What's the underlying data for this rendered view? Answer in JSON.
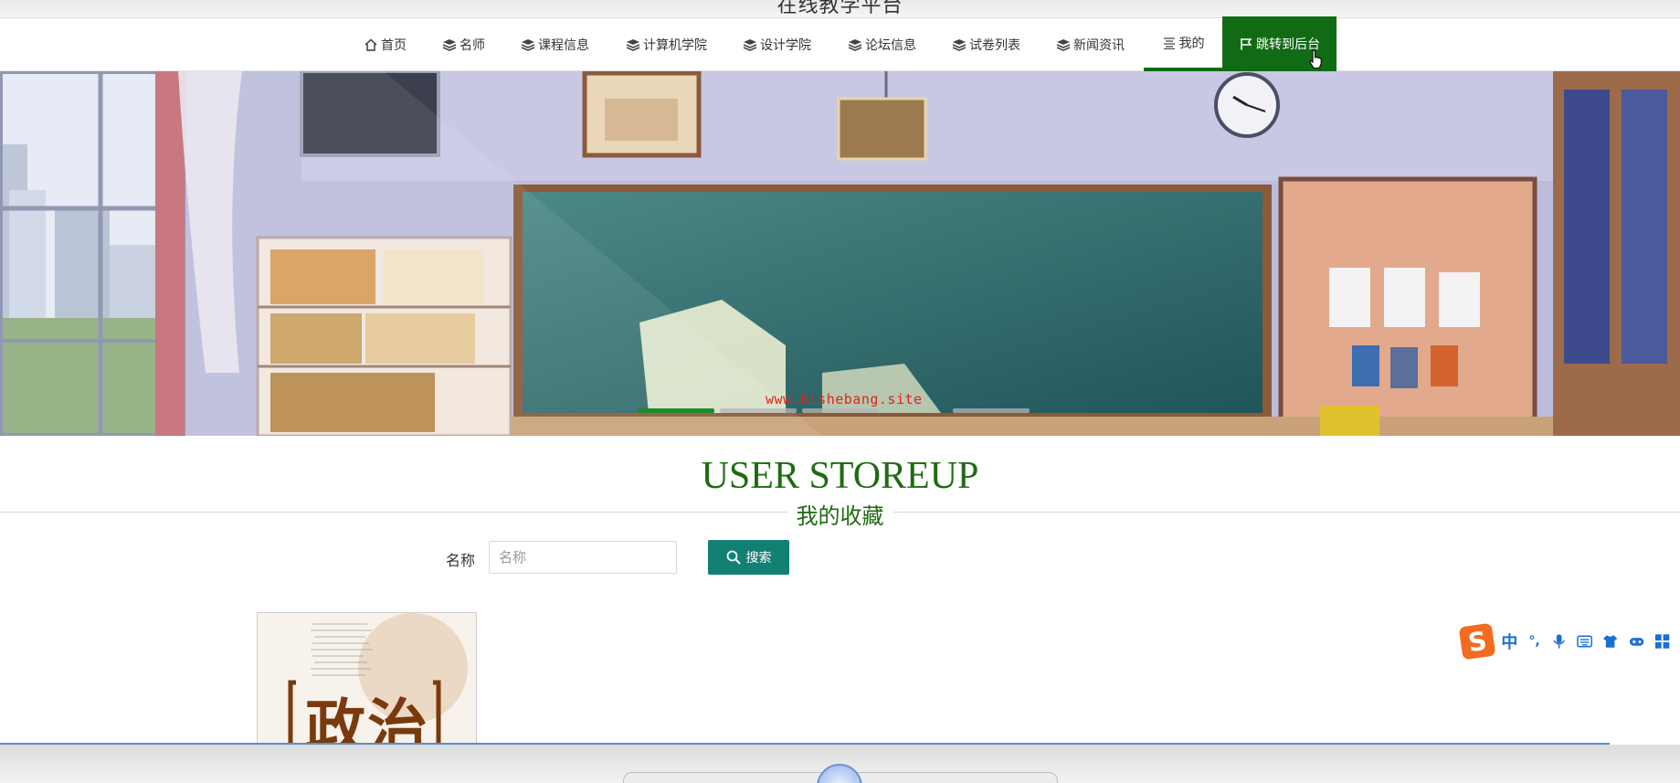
{
  "site": {
    "title": "在线教学平台"
  },
  "nav": {
    "items": [
      {
        "label": "首页",
        "icon": "home-icon"
      },
      {
        "label": "名师",
        "icon": "layers-icon"
      },
      {
        "label": "课程信息",
        "icon": "layers-icon"
      },
      {
        "label": "计算机学院",
        "icon": "layers-icon"
      },
      {
        "label": "设计学院",
        "icon": "layers-icon"
      },
      {
        "label": "论坛信息",
        "icon": "layers-icon"
      },
      {
        "label": "试卷列表",
        "icon": "layers-icon"
      },
      {
        "label": "新闻资讯",
        "icon": "layers-icon"
      },
      {
        "label": "我的",
        "icon": "menu-lines-icon"
      },
      {
        "label": "跳转到后台",
        "icon": "flag-icon"
      }
    ],
    "active_color": "#116b14"
  },
  "banner": {
    "watermark": "www.bishebang.site",
    "slides_total": 4,
    "slide_current": 1
  },
  "section": {
    "title_en": "USER STOREUP",
    "title_cn": "我的收藏",
    "color": "#1f6b12"
  },
  "search": {
    "label": "名称",
    "placeholder": "名称",
    "value": "",
    "button_label": "搜索",
    "button_color": "#128074"
  },
  "items": [
    {
      "cover_text": "政治"
    }
  ],
  "ime": {
    "text": "中",
    "punct": "°,"
  }
}
